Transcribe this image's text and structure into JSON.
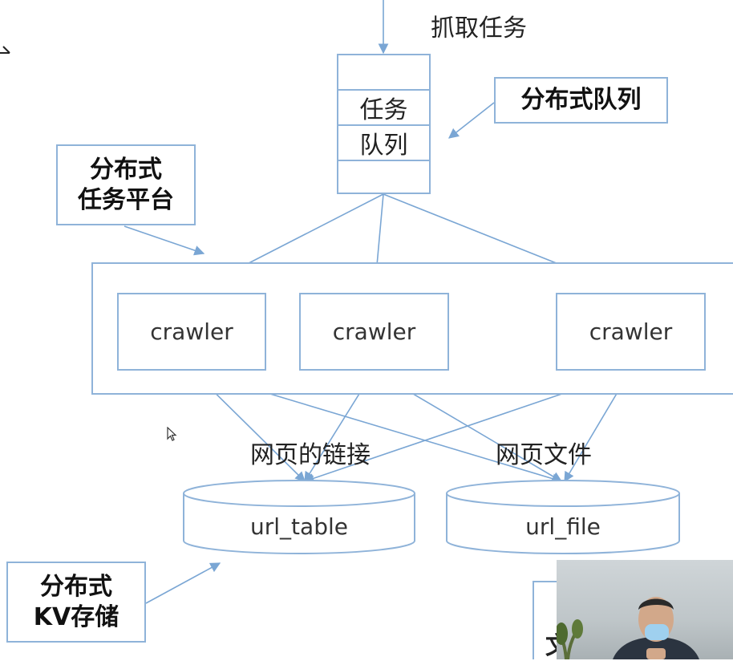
{
  "labels": {
    "fetch_task": "抓取任务",
    "queue_row1": "任务",
    "queue_row2": "队列",
    "distributed_queue": "分布式队列",
    "task_platform_line1": "分布式",
    "task_platform_line2": "任务平台",
    "crawler1": "crawler",
    "crawler2": "crawler",
    "crawler3": "crawler",
    "page_links": "网页的链接",
    "page_files": "网页文件",
    "url_table": "url_table",
    "url_file": "url_file",
    "kv_line1": "分布式",
    "kv_line2": "KV存储",
    "partial_char": "文"
  },
  "colors": {
    "line": "#7aa6d4",
    "border": "#8fb3d9",
    "background": "#ffffff"
  },
  "icons": {
    "cursor": "mouse-pointer-icon"
  }
}
